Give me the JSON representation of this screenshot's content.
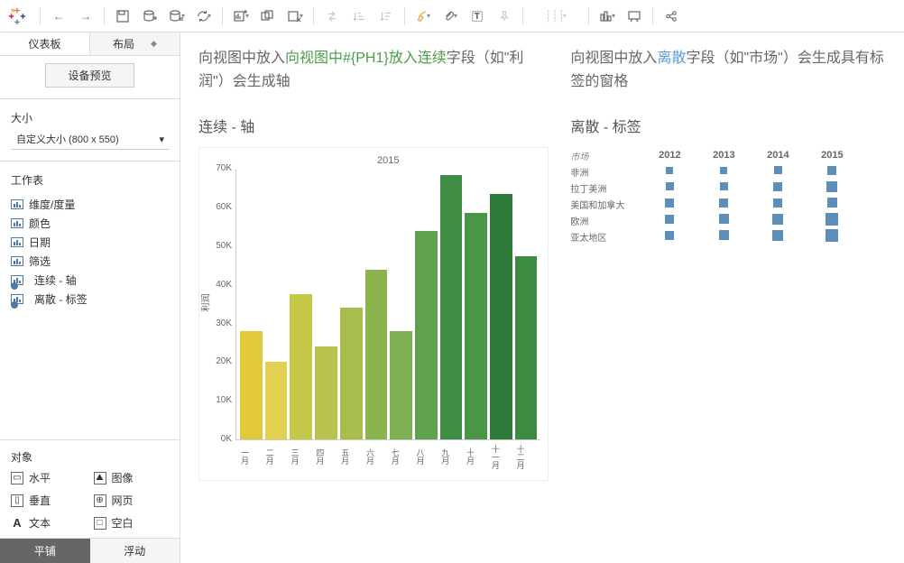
{
  "toolbar": {
    "logo": "tableau"
  },
  "sidebar": {
    "tabs": {
      "dashboard": "仪表板",
      "layout": "布局"
    },
    "device_preview": "设备预览",
    "size_label": "大小",
    "size_value": "自定义大小 (800 x 550)",
    "worksheets_label": "工作表",
    "sheets": [
      {
        "label": "维度/度量"
      },
      {
        "label": "颜色"
      },
      {
        "label": "日期"
      },
      {
        "label": "筛选"
      },
      {
        "label": "连续 - 轴",
        "checked": true
      },
      {
        "label": "离散 - 标签",
        "checked": true
      }
    ],
    "objects_label": "对象",
    "objects": [
      {
        "label": "水平",
        "ic": "▭"
      },
      {
        "label": "图像",
        "ic": "⛰"
      },
      {
        "label": "垂直",
        "ic": "▯"
      },
      {
        "label": "网页",
        "ic": "⊕"
      },
      {
        "label": "文本",
        "ic": "A"
      },
      {
        "label": "空白",
        "ic": "□"
      }
    ],
    "mode": {
      "tiled": "平铺",
      "floating": "浮动"
    }
  },
  "canvas": {
    "left": {
      "desc_pre": "向视图中放入",
      "desc_green": "向视图中#{PH1}放入连续",
      "desc_post": "字段（如\"利润\"）会生成轴",
      "title": "连续 - 轴"
    },
    "right": {
      "desc_pre": "向视图中放入",
      "desc_blue": "离散",
      "desc_post": "字段（如\"市场\"）会生成具有标签的窗格",
      "title": "离散 - 标签"
    }
  },
  "chart_data": {
    "type": "bar",
    "title": "2015",
    "ylabel": "利润",
    "ylim": [
      0,
      70000
    ],
    "yticks": [
      "0K",
      "10K",
      "20K",
      "30K",
      "40K",
      "50K",
      "60K",
      "70K"
    ],
    "categories": [
      "一月",
      "二月",
      "三月",
      "四月",
      "五月",
      "六月",
      "七月",
      "八月",
      "九月",
      "十月",
      "十一月",
      "十二月"
    ],
    "values": [
      28000,
      20000,
      37500,
      24000,
      34000,
      44000,
      28000,
      54000,
      68500,
      58500,
      63500,
      47500
    ],
    "colors": [
      "#e0ca3c",
      "#e3cf50",
      "#c6c84a",
      "#b8c24e",
      "#a7bd4c",
      "#8cb44e",
      "#7eb051",
      "#5fa14e",
      "#3f8d44",
      "#4b9549",
      "#2d7a38",
      "#3c8b42"
    ]
  },
  "discrete_data": {
    "row_header": "市场",
    "cols": [
      "2012",
      "2013",
      "2014",
      "2015"
    ],
    "rows": [
      {
        "label": "非洲",
        "sizes": [
          8,
          8,
          9,
          10
        ]
      },
      {
        "label": "拉丁美洲",
        "sizes": [
          9,
          9,
          10,
          12
        ]
      },
      {
        "label": "美国和加拿大",
        "sizes": [
          10,
          10,
          10,
          11
        ]
      },
      {
        "label": "欧洲",
        "sizes": [
          10,
          11,
          12,
          14
        ]
      },
      {
        "label": "亚太地区",
        "sizes": [
          10,
          11,
          12,
          14
        ]
      }
    ]
  }
}
